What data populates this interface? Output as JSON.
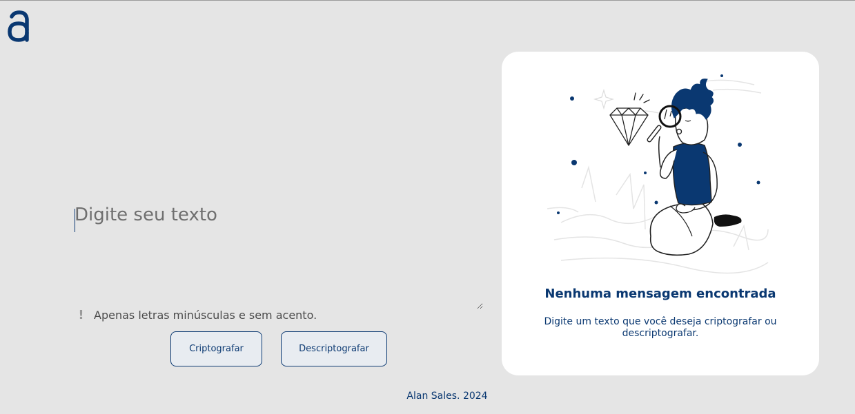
{
  "brand": {
    "logo_letter": "a",
    "logo_color": "#0a3871"
  },
  "input": {
    "placeholder": "Digite seu texto",
    "value": ""
  },
  "hint": {
    "icon": "exclamation-icon",
    "text": "Apenas letras minúsculas e sem acento."
  },
  "actions": {
    "encrypt_label": "Criptografar",
    "decrypt_label": "Descriptografar"
  },
  "output": {
    "illustration": "person-with-magnifying-glass-diamond",
    "title": "Nenhuma mensagem encontrada",
    "description": "Digite um texto que você deseja criptografar ou descriptografar."
  },
  "footer": {
    "text": "Alan Sales. 2024"
  },
  "colors": {
    "accent": "#0a3871",
    "background": "#e5e5e5",
    "panel": "#ffffff"
  }
}
